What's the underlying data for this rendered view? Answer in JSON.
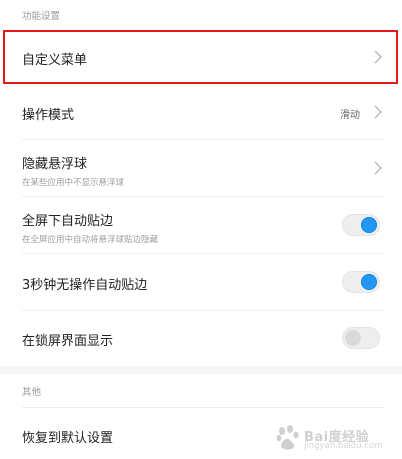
{
  "sections": {
    "features_header": "功能设置",
    "other_header": "其他"
  },
  "rows": {
    "custom_menu": {
      "label": "自定义菜单"
    },
    "operation_mode": {
      "label": "操作模式",
      "value": "滑动"
    },
    "hide_ball": {
      "label": "隐藏悬浮球",
      "sublabel": "在某些应用中不显示悬浮球"
    },
    "fullscreen_snap": {
      "label": "全屏下自动贴边",
      "sublabel": "在全屏应用中自动将悬浮球贴边隐藏",
      "enabled": true
    },
    "idle_snap": {
      "label": "3秒钟无操作自动贴边",
      "enabled": true
    },
    "lockscreen_show": {
      "label": "在锁屏界面显示",
      "enabled": false
    },
    "restore_defaults": {
      "label": "恢复到默认设置"
    }
  },
  "colors": {
    "toggle_on": "#2196f3",
    "highlight": "#e21a1a"
  },
  "watermark": {
    "brand": "Bai度经验",
    "url": "jingyan.baidu.com"
  }
}
